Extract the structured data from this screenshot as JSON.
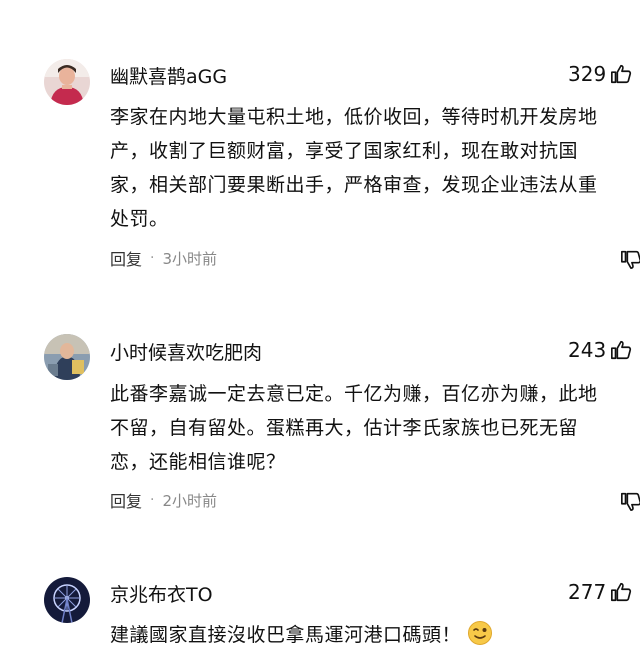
{
  "comments": [
    {
      "username": "幽默喜鹊aGG",
      "likes": "329",
      "avatar_icon": "person-avatar-icon",
      "lines": [
        "李家在内地大量屯积土地，低价收回，等待时机开发房地",
        "产，收割了巨额财富，享受了国家红利，现在敢对抗国",
        "家，相关部门要果断出手，严格审查，发现企业违法从重",
        "处罚。"
      ],
      "reply_label": "回复",
      "separator": "·",
      "time": "3小时前"
    },
    {
      "username": "小时候喜欢吃肥肉",
      "likes": "243",
      "avatar_icon": "person-avatar-icon",
      "lines": [
        "此番李嘉诚一定去意已定。千亿为赚，百亿亦为赚，此地",
        "不留，自有留处。蛋糕再大，估计李氏家族也已死无留",
        "恋，还能相信谁呢？"
      ],
      "reply_label": "回复",
      "separator": "·",
      "time": "2小时前"
    },
    {
      "username": "京兆布衣TO",
      "likes": "277",
      "avatar_icon": "ferris-wheel-avatar-icon",
      "lines": [
        "建議國家直接沒收巴拿馬運河港口碼頭！"
      ],
      "emoji_icon": "wink-emoji-icon"
    }
  ],
  "colors": {
    "text": "#111111",
    "meta": "#888888",
    "background": "#ffffff"
  }
}
